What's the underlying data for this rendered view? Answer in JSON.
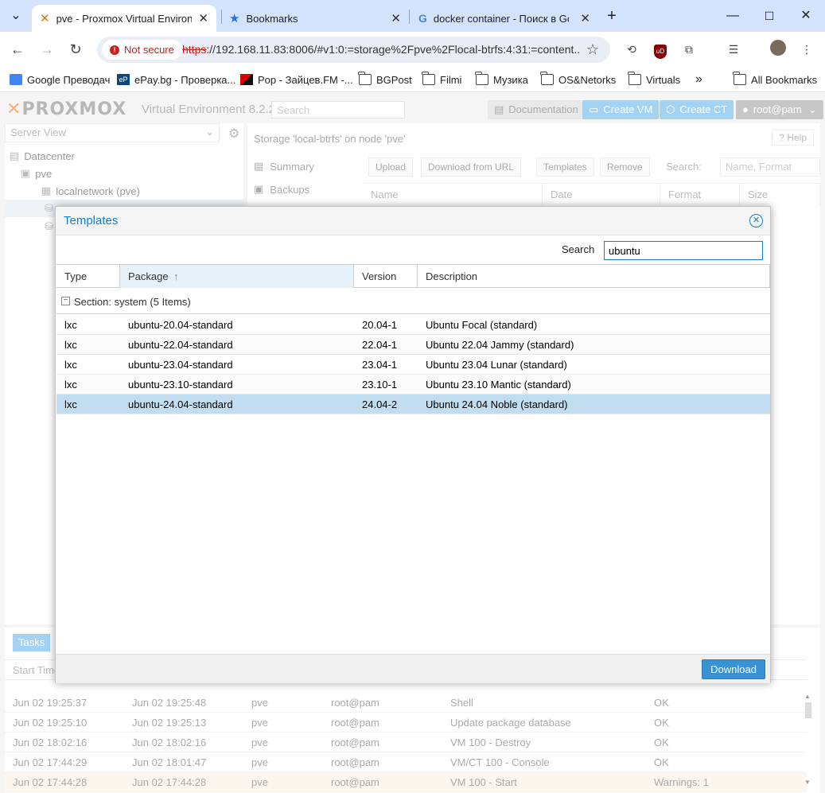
{
  "browser": {
    "tabs": [
      {
        "title": "pve - Proxmox Virtual Environment",
        "active": true
      },
      {
        "title": "Bookmarks",
        "active": false
      },
      {
        "title": "docker container - Поиск в Google",
        "active": false
      }
    ],
    "address": {
      "security_label": "Not secure",
      "scheme": "https",
      "rest": "://192.168.11.83:8006/#v1:0:=storage%2Fpve%2Flocal-btrfs:4:31:=content..."
    },
    "bookmarks": [
      {
        "label": "Google Преводач",
        "icon": "google-translate-icon"
      },
      {
        "label": "ePay.bg - Проверка...",
        "icon": "epay-icon"
      },
      {
        "label": "Pop - Зайцев.FM -...",
        "icon": "zaycev-icon"
      },
      {
        "label": "BGPost",
        "icon": "folder-icon"
      },
      {
        "label": "Filmi",
        "icon": "folder-icon"
      },
      {
        "label": "Музика",
        "icon": "folder-icon"
      },
      {
        "label": "OS&Netorks",
        "icon": "folder-icon"
      },
      {
        "label": "Virtuals",
        "icon": "folder-icon"
      },
      {
        "label": "All Bookmarks",
        "icon": "folder-icon"
      }
    ],
    "bookmarks_overflow": "»"
  },
  "header": {
    "logo": "PROXMOX",
    "subtitle": "Virtual Environment 8.2.2",
    "search_placeholder": "Search",
    "documentation": "Documentation",
    "create_vm": "Create VM",
    "create_ct": "Create CT",
    "user": "root@pam"
  },
  "tree": {
    "view_label": "Server View",
    "datacenter": "Datacenter",
    "node": "pve",
    "localnetwork": "localnetwork (pve)"
  },
  "content": {
    "title": "Storage 'local-btrfs' on node 'pve'",
    "help": "Help",
    "side_tabs": [
      "Summary",
      "Backups"
    ],
    "toolbar": {
      "upload": "Upload",
      "download_url": "Download from URL",
      "templates": "Templates",
      "remove": "Remove",
      "search_label": "Search:",
      "search_placeholder": "Name, Format"
    },
    "columns": [
      "Name",
      "Date",
      "Format",
      "Size"
    ]
  },
  "tasks": {
    "tab_label": "Tasks",
    "header_start": "Start Time",
    "rows": [
      {
        "start": "Jun 02 19:25:37",
        "end": "Jun 02 19:25:48",
        "node": "pve",
        "user": "root@pam",
        "desc": "Shell",
        "status": "OK",
        "warn": false
      },
      {
        "start": "Jun 02 19:25:10",
        "end": "Jun 02 19:25:13",
        "node": "pve",
        "user": "root@pam",
        "desc": "Update package database",
        "status": "OK",
        "warn": false
      },
      {
        "start": "Jun 02 18:02:16",
        "end": "Jun 02 18:02:16",
        "node": "pve",
        "user": "root@pam",
        "desc": "VM 100 - Destroy",
        "status": "OK",
        "warn": false
      },
      {
        "start": "Jun 02 17:44:29",
        "end": "Jun 02 18:01:47",
        "node": "pve",
        "user": "root@pam",
        "desc": "VM/CT 100 - Console",
        "status": "OK",
        "warn": false
      },
      {
        "start": "Jun 02 17:44:28",
        "end": "Jun 02 17:44:28",
        "node": "pve",
        "user": "root@pam",
        "desc": "VM 100 - Start",
        "status": "Warnings: 1",
        "warn": true
      }
    ]
  },
  "dialog": {
    "title": "Templates",
    "search_label": "Search",
    "search_value": "ubuntu",
    "columns": {
      "type": "Type",
      "package": "Package",
      "version": "Version",
      "description": "Description"
    },
    "sort_arrow": "↑",
    "group_label": "Section: system (5 Items)",
    "rows": [
      {
        "type": "lxc",
        "package": "ubuntu-20.04-standard",
        "version": "20.04-1",
        "description": "Ubuntu Focal (standard)",
        "selected": false
      },
      {
        "type": "lxc",
        "package": "ubuntu-22.04-standard",
        "version": "22.04-1",
        "description": "Ubuntu 22.04 Jammy (standard)",
        "selected": false
      },
      {
        "type": "lxc",
        "package": "ubuntu-23.04-standard",
        "version": "23.04-1",
        "description": "Ubuntu 23.04 Lunar (standard)",
        "selected": false
      },
      {
        "type": "lxc",
        "package": "ubuntu-23.10-standard",
        "version": "23.10-1",
        "description": "Ubuntu 23.10 Mantic (standard)",
        "selected": false
      },
      {
        "type": "lxc",
        "package": "ubuntu-24.04-standard",
        "version": "24.04-2",
        "description": "Ubuntu 24.04 Noble (standard)",
        "selected": true
      }
    ],
    "download": "Download"
  },
  "colors": {
    "accent": "#157fcc",
    "selected_row": "#c1ddf1",
    "download_button": "#3892d4"
  }
}
